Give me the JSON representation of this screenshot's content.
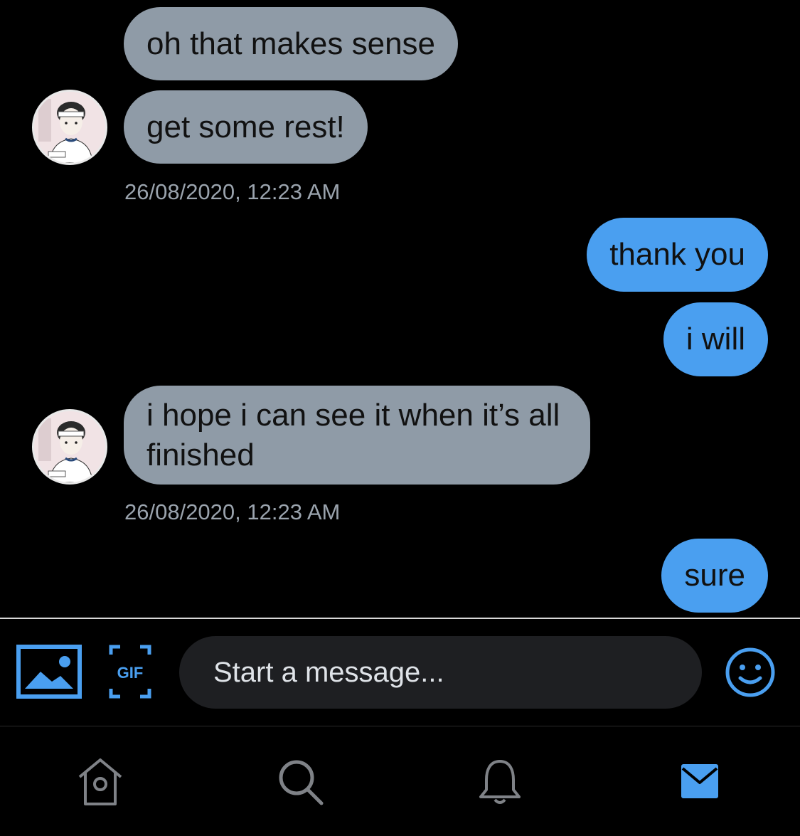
{
  "conversation": {
    "messages": [
      {
        "text": "oh that makes sense"
      },
      {
        "text": "get some rest!"
      },
      {
        "text": "thank you"
      },
      {
        "text": "i will"
      },
      {
        "text": "i hope i can see it when it’s all finished"
      },
      {
        "text": "sure"
      }
    ],
    "timestamps": [
      "26/08/2020, 12:23 AM",
      "26/08/2020, 12:23 AM"
    ]
  },
  "composer": {
    "placeholder": "Start a message...",
    "gif_label": "GIF",
    "icons": [
      "image-icon",
      "gif-icon",
      "emoji-icon"
    ]
  },
  "tab_bar": {
    "items": [
      "home-icon",
      "search-icon",
      "notifications-icon",
      "messages-icon"
    ],
    "active": "messages-icon"
  },
  "colors": {
    "background": "#000000",
    "incoming_bubble": "#8f9ba7",
    "outgoing_bubble": "#4a9ff0",
    "accent": "#4a9ff0",
    "inactive_icon": "#7f8287",
    "input_background": "#1e1f22"
  }
}
